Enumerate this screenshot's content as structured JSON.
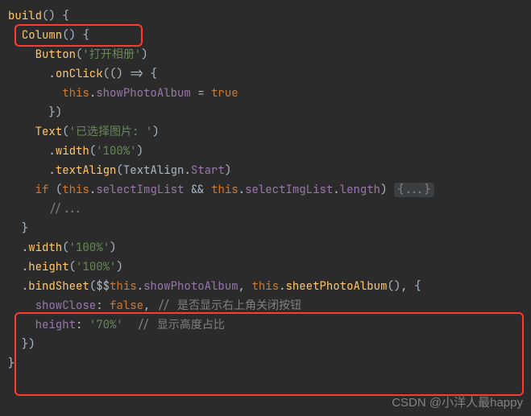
{
  "code": {
    "l1": {
      "fn": "build",
      "brace": "() {"
    },
    "l2": {
      "fn": "Column",
      "brace": "() {"
    },
    "l3": {
      "fn": "Button",
      "arg": "'打开相册'"
    },
    "l4": {
      "method": "onClick",
      "lambda": "(() => {"
    },
    "l5": {
      "kw_this": "this",
      "prop": "showPhotoAlbum",
      "eq": " = ",
      "val": "true"
    },
    "l6": {
      "close": "})"
    },
    "l7": {
      "fn": "Text",
      "arg": "'已选择图片: '"
    },
    "l8": {
      "method": "width",
      "arg": "'100%'"
    },
    "l9": {
      "method": "textAlign",
      "arg_obj": "TextAlign",
      "arg_prop": "Start"
    },
    "l10": {
      "kw_if": "if",
      "open": " (",
      "this1": "this",
      "p1": "selectImgList",
      "and": " && ",
      "this2": "this",
      "p2": "selectImgList",
      "p3": "length",
      "close": ") ",
      "fold": "{...}"
    },
    "l11": {
      "comment": "//..."
    },
    "l12": {
      "close": "}"
    },
    "l13": {
      "method": "width",
      "arg": "'100%'"
    },
    "l14": {
      "method": "height",
      "arg": "'100%'"
    },
    "l15": {
      "method": "bindSheet",
      "pre": "($$",
      "this1": "this",
      "p1": "showPhotoAlbum",
      "comma": ", ",
      "this2": "this",
      "p2": "sheetPhotoAlbum",
      "call": "(), {"
    },
    "l16": {
      "key": "showClose",
      "val": "false",
      "comma": ",",
      "comment": " // 是否显示右上角关闭按钮"
    },
    "l17": {
      "key": "height",
      "val": "'70%'",
      "comment": "  // 显示高度占比"
    },
    "l18": {
      "close": "})"
    },
    "l19": {
      "close": "}"
    }
  },
  "watermark": "CSDN @小洋人最happy"
}
